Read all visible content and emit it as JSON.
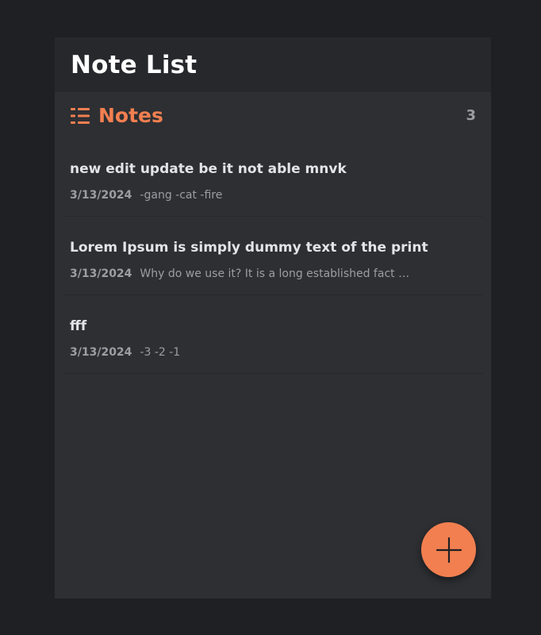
{
  "header": {
    "title": "Note List"
  },
  "section": {
    "title": "Notes",
    "count": "3",
    "icon": "list-icon"
  },
  "notes": [
    {
      "title": "new edit update be it not able mnvk",
      "date": "3/13/2024",
      "preview": "-gang -cat -fire"
    },
    {
      "title": "Lorem Ipsum is simply dummy text of the print",
      "date": "3/13/2024",
      "preview": "Why do we use it? It is a long established fact that a reader will be distracted"
    },
    {
      "title": "fff",
      "date": "3/13/2024",
      "preview": "-3 -2 -1"
    }
  ],
  "fab": {
    "icon": "plus-icon"
  },
  "colors": {
    "accent": "#f27f50",
    "background": "#1f2023",
    "panel": "#2d2f33",
    "header": "#27282c"
  }
}
